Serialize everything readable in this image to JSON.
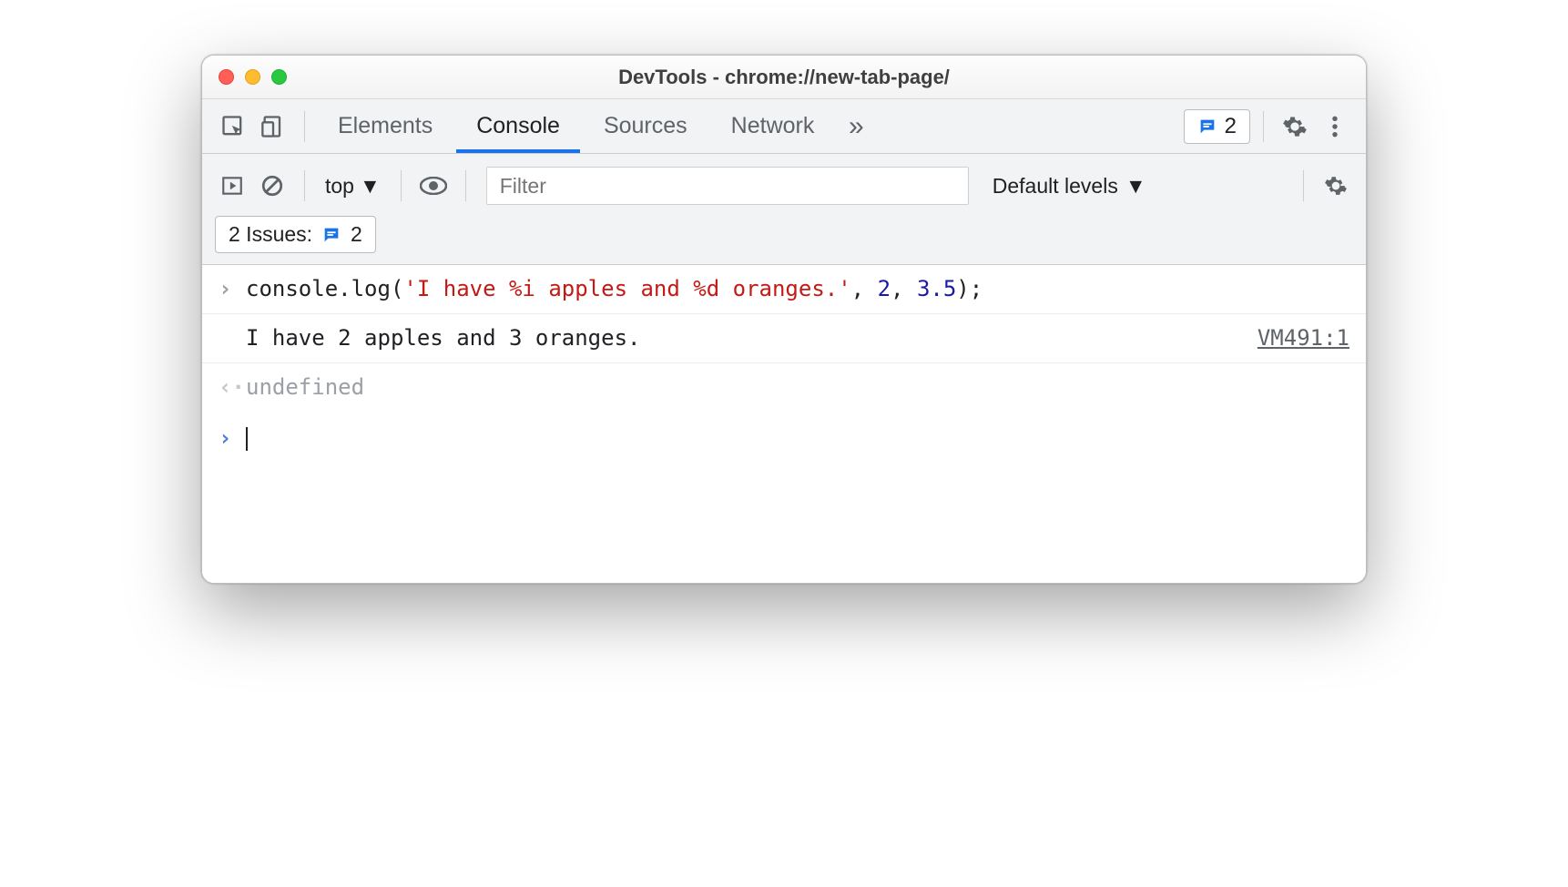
{
  "window": {
    "title": "DevTools - chrome://new-tab-page/"
  },
  "tabs": {
    "elements": "Elements",
    "console": "Console",
    "sources": "Sources",
    "network": "Network"
  },
  "issues_badge_count": "2",
  "toolbar": {
    "context": "top",
    "filter_placeholder": "Filter",
    "levels": "Default levels"
  },
  "issues_pill": {
    "label": "2 Issues:",
    "count": "2"
  },
  "console": {
    "input_prefix": "console.log(",
    "input_string": "'I have %i apples and %d oranges.'",
    "input_sep1": ", ",
    "input_arg1": "2",
    "input_sep2": ", ",
    "input_arg2": "3.5",
    "input_suffix": ");",
    "output": "I have 2 apples and 3 oranges.",
    "source_link": "VM491:1",
    "return_value": "undefined"
  }
}
